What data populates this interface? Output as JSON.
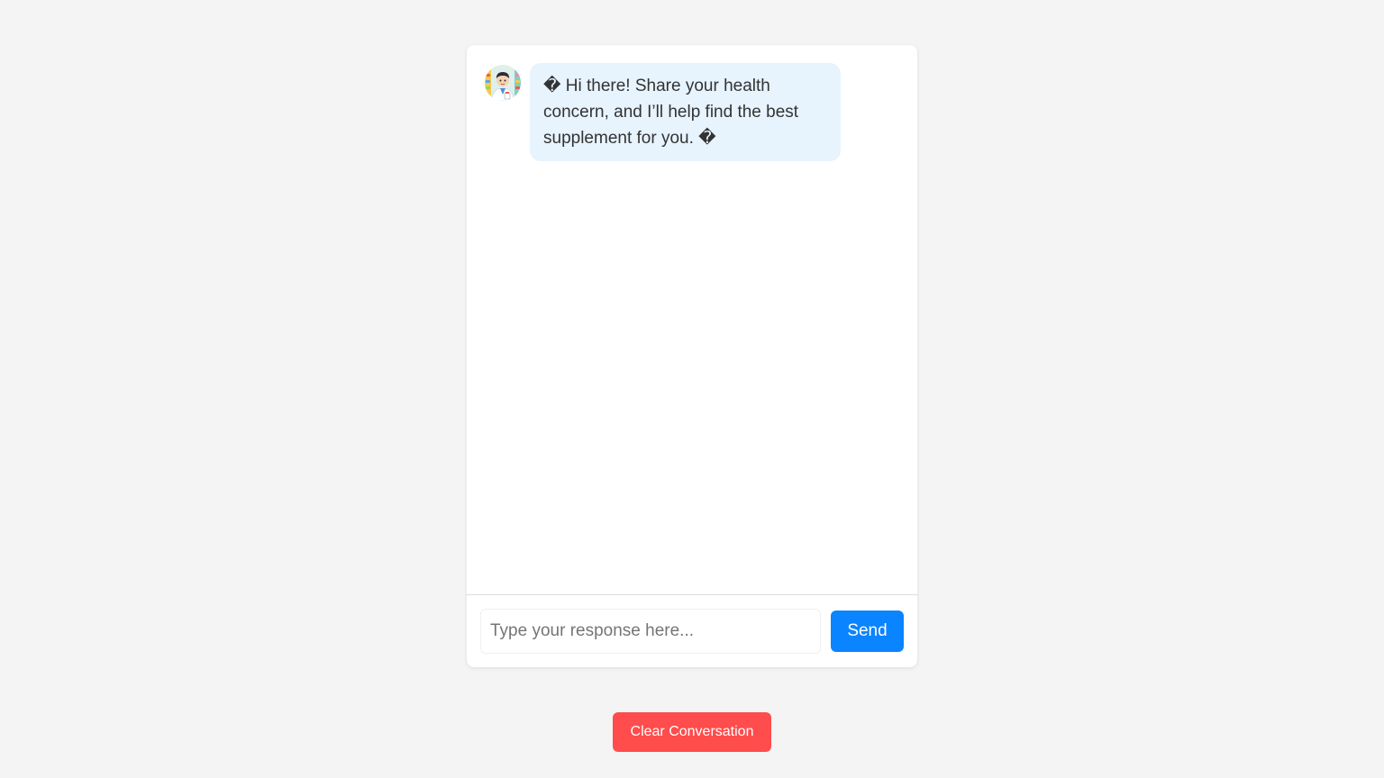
{
  "chat": {
    "messages": [
      {
        "sender": "bot",
        "avatar_icon": "pharmacist-avatar-icon",
        "text": "� Hi there! Share your health concern, and I’ll help find the best supplement for you. �"
      }
    ],
    "input": {
      "value": "",
      "placeholder": "Type your response here..."
    },
    "send_label": "Send"
  },
  "clear_label": "Clear Conversation",
  "colors": {
    "page_background": "#f4f4f4",
    "bot_bubble": "#e7f3fd",
    "send_button": "#0a84ff",
    "clear_button": "#ff4c4c"
  }
}
